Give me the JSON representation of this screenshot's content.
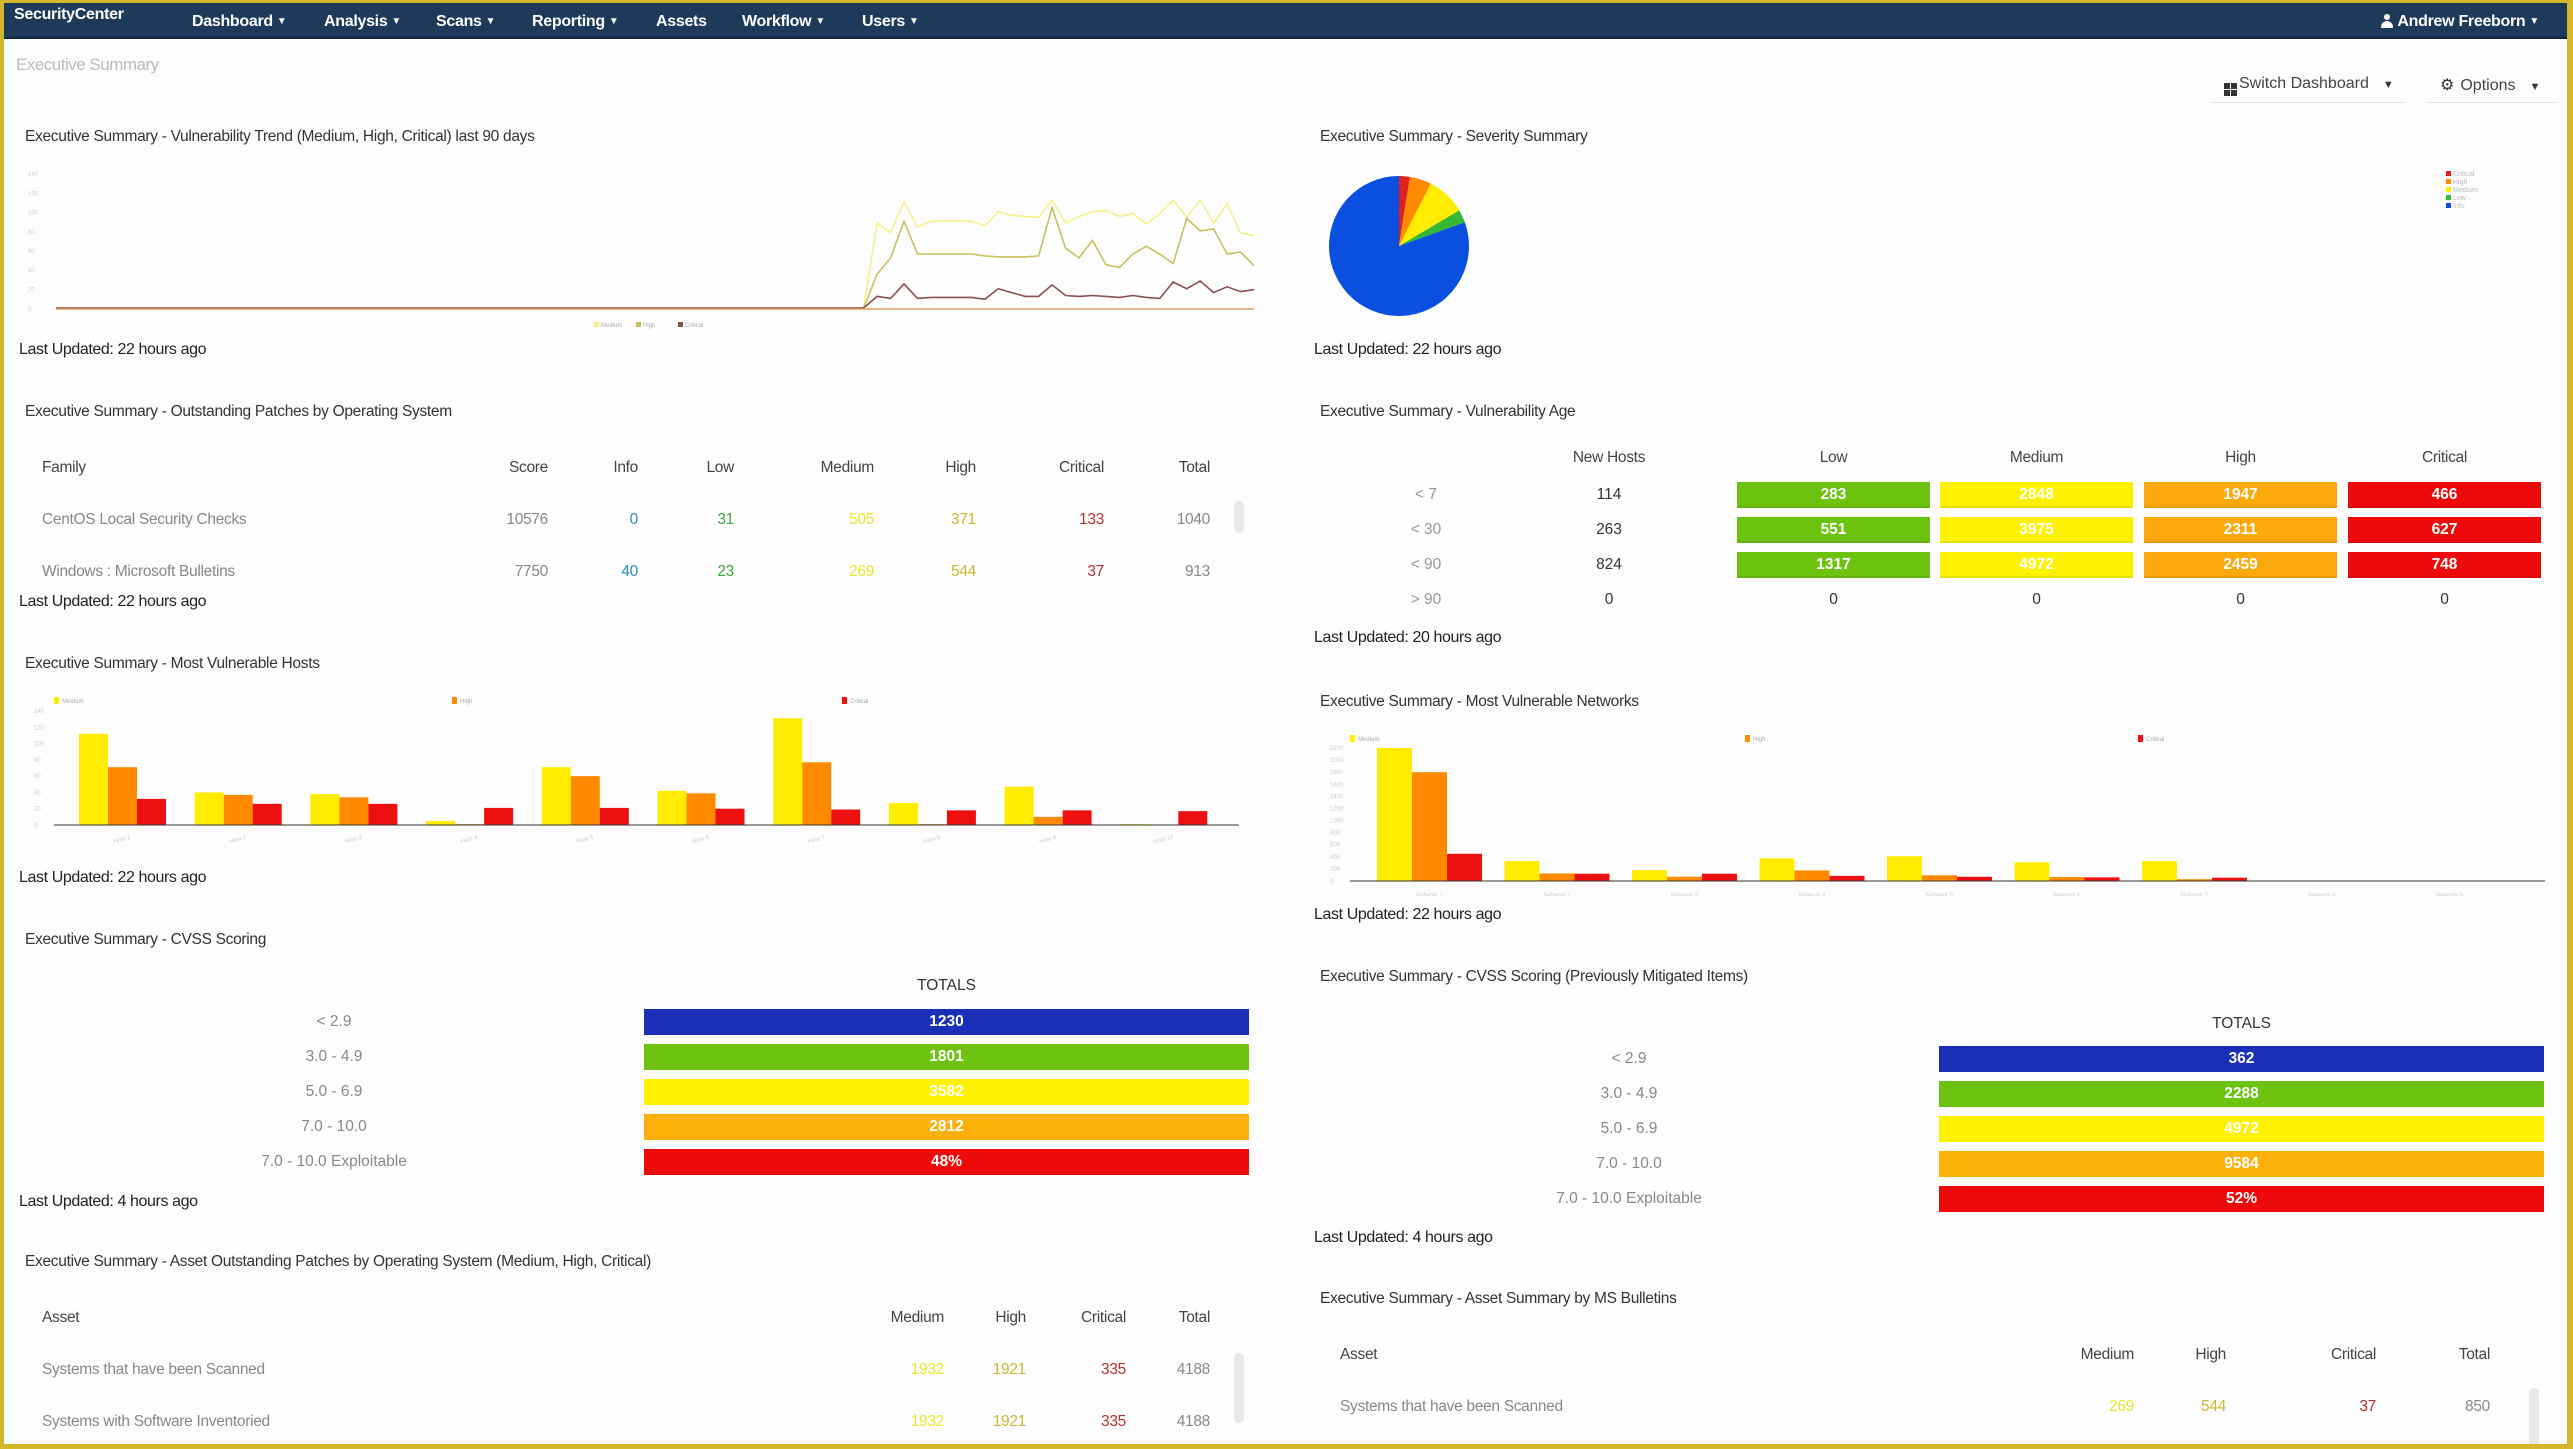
{
  "app": {
    "brand": "SecurityCenter",
    "nav": [
      "Dashboard",
      "Analysis",
      "Scans",
      "Reporting",
      "Assets",
      "Workflow",
      "Users"
    ],
    "nav_has_caret": [
      true,
      true,
      true,
      true,
      false,
      true,
      true
    ],
    "user": "Andrew Freeborn",
    "page_title": "Executive Summary",
    "switch_dashboard": "Switch Dashboard",
    "options": "Options"
  },
  "colors": {
    "nav_bg": "#1d3a5a",
    "frame": "#d4b62a",
    "info": "#0a4fe0",
    "low": "#6cc20f",
    "medium": "#fff200",
    "high": "#fba90a",
    "high_bar": "#ff8a00",
    "critical": "#ee0a0a",
    "cvss_low": "#1a2fb8"
  },
  "panels": {
    "trend": {
      "title": "Executive Summary - Vulnerability Trend (Medium, High, Critical) last 90 days",
      "updated": "Last Updated: 22 hours ago"
    },
    "severity": {
      "title": "Executive Summary - Severity Summary",
      "updated": "Last Updated: 22 hours ago"
    },
    "patches": {
      "title": "Executive Summary - Outstanding Patches by Operating System",
      "updated": "Last Updated: 22 hours ago",
      "headers": [
        "Family",
        "Score",
        "Info",
        "Low",
        "Medium",
        "High",
        "Critical",
        "Total"
      ],
      "rows": [
        {
          "family": "CentOS Local Security Checks",
          "score": "10576",
          "info": "0",
          "low": "31",
          "medium": "505",
          "high": "371",
          "critical": "133",
          "total": "1040"
        },
        {
          "family": "Windows : Microsoft Bulletins",
          "score": "7750",
          "info": "40",
          "low": "23",
          "medium": "269",
          "high": "544",
          "critical": "37",
          "total": "913"
        }
      ]
    },
    "age": {
      "title": "Executive Summary - Vulnerability Age",
      "updated": "Last Updated: 20 hours ago",
      "headers": [
        "New Hosts",
        "Low",
        "Medium",
        "High",
        "Critical"
      ],
      "rows": [
        {
          "label": "< 7",
          "new_hosts": "114",
          "low": "283",
          "medium": "2848",
          "high": "1947",
          "critical": "466"
        },
        {
          "label": "< 30",
          "new_hosts": "263",
          "low": "551",
          "medium": "3975",
          "high": "2311",
          "critical": "627"
        },
        {
          "label": "< 90",
          "new_hosts": "824",
          "low": "1317",
          "medium": "4972",
          "high": "2459",
          "critical": "748"
        },
        {
          "label": "> 90",
          "new_hosts": "0",
          "low": "0",
          "medium": "0",
          "high": "0",
          "critical": "0"
        }
      ]
    },
    "hosts": {
      "title": "Executive Summary - Most Vulnerable Hosts",
      "updated": "Last Updated: 22 hours ago"
    },
    "networks": {
      "title": "Executive Summary - Most Vulnerable Networks",
      "updated": "Last Updated: 22 hours ago"
    },
    "cvss": {
      "title": "Executive Summary - CVSS Scoring",
      "updated": "Last Updated: 4 hours ago",
      "totals_label": "TOTALS",
      "rows": [
        {
          "label": "< 2.9",
          "value": "1230",
          "color": "#1a2fb8"
        },
        {
          "label": "3.0 - 4.9",
          "value": "1801",
          "color": "#6cc20f"
        },
        {
          "label": "5.0 - 6.9",
          "value": "3582",
          "color": "#fff200"
        },
        {
          "label": "7.0 - 10.0",
          "value": "2812",
          "color": "#fbb00a"
        },
        {
          "label": "7.0 - 10.0 Exploitable",
          "value": "48%",
          "color": "#ee0a0a"
        }
      ]
    },
    "cvss_mitigated": {
      "title": "Executive Summary - CVSS Scoring (Previously Mitigated Items)",
      "updated": "Last Updated: 4 hours ago",
      "totals_label": "TOTALS",
      "rows": [
        {
          "label": "< 2.9",
          "value": "362",
          "color": "#1a2fb8"
        },
        {
          "label": "3.0 - 4.9",
          "value": "2288",
          "color": "#6cc20f"
        },
        {
          "label": "5.0 - 6.9",
          "value": "4972",
          "color": "#fff200"
        },
        {
          "label": "7.0 - 10.0",
          "value": "9584",
          "color": "#fbb00a"
        },
        {
          "label": "7.0 - 10.0 Exploitable",
          "value": "52%",
          "color": "#ee0a0a"
        }
      ]
    },
    "asset_patches": {
      "title": "Executive Summary - Asset Outstanding Patches by Operating System (Medium, High, Critical)",
      "headers": [
        "Asset",
        "Medium",
        "High",
        "Critical",
        "Total"
      ],
      "rows": [
        {
          "asset": "Systems that have been Scanned",
          "medium": "1932",
          "high": "1921",
          "critical": "335",
          "total": "4188"
        },
        {
          "asset": "Systems with Software Inventoried",
          "medium": "1932",
          "high": "1921",
          "critical": "335",
          "total": "4188"
        }
      ]
    },
    "ms_bulletins": {
      "title": "Executive Summary - Asset Summary by MS Bulletins",
      "headers": [
        "Asset",
        "Medium",
        "High",
        "Critical",
        "Total"
      ],
      "rows": [
        {
          "asset": "Systems that have been Scanned",
          "medium": "269",
          "high": "544",
          "critical": "37",
          "total": "850"
        }
      ]
    }
  },
  "chart_data": [
    {
      "id": "trend",
      "type": "line",
      "title": "Executive Summary - Vulnerability Trend (Medium, High, Critical) last 90 days",
      "xlabel": "",
      "ylabel": "",
      "ylim": [
        0,
        140
      ],
      "legend": "bottom",
      "legend_entries": [
        "Medium",
        "High",
        "Critical"
      ],
      "points_count": 90,
      "series": [
        {
          "name": "Medium",
          "color": "#f5f08a",
          "values": [
            0,
            0,
            0,
            0,
            0,
            0,
            0,
            0,
            0,
            0,
            0,
            0,
            0,
            0,
            0,
            0,
            0,
            0,
            0,
            0,
            0,
            0,
            0,
            0,
            0,
            0,
            0,
            0,
            0,
            0,
            0,
            0,
            0,
            0,
            0,
            0,
            0,
            0,
            0,
            0,
            0,
            0,
            0,
            0,
            0,
            0,
            0,
            0,
            0,
            0,
            0,
            0,
            0,
            0,
            0,
            0,
            0,
            0,
            0,
            0,
            0,
            88,
            78,
            110,
            84,
            90,
            90,
            90,
            90,
            85,
            100,
            96,
            95,
            94,
            112,
            88,
            95,
            100,
            101,
            95,
            98,
            87,
            98,
            112,
            94,
            112,
            88,
            108,
            78,
            75
          ]
        },
        {
          "name": "High",
          "color": "#c8c060",
          "values": [
            0,
            0,
            0,
            0,
            0,
            0,
            0,
            0,
            0,
            0,
            0,
            0,
            0,
            0,
            0,
            0,
            0,
            0,
            0,
            0,
            0,
            0,
            0,
            0,
            0,
            0,
            0,
            0,
            0,
            0,
            0,
            0,
            0,
            0,
            0,
            0,
            0,
            0,
            0,
            0,
            0,
            0,
            0,
            0,
            0,
            0,
            0,
            0,
            0,
            0,
            0,
            0,
            0,
            0,
            0,
            0,
            0,
            0,
            0,
            0,
            0,
            35,
            52,
            90,
            56,
            56,
            56,
            56,
            56,
            54,
            53,
            53,
            53,
            54,
            104,
            62,
            52,
            70,
            45,
            42,
            56,
            64,
            56,
            46,
            93,
            80,
            82,
            56,
            58,
            44
          ]
        },
        {
          "name": "Critical",
          "color": "#8a5050",
          "values": [
            0,
            0,
            0,
            0,
            0,
            0,
            0,
            0,
            0,
            0,
            0,
            0,
            0,
            0,
            0,
            0,
            0,
            0,
            0,
            0,
            0,
            0,
            0,
            0,
            0,
            0,
            0,
            0,
            0,
            0,
            0,
            0,
            0,
            0,
            0,
            0,
            0,
            0,
            0,
            0,
            0,
            0,
            0,
            0,
            0,
            0,
            0,
            0,
            0,
            0,
            0,
            0,
            0,
            0,
            0,
            0,
            0,
            0,
            0,
            0,
            0,
            12,
            10,
            25,
            10,
            11,
            11,
            11,
            11,
            9,
            20,
            16,
            12,
            12,
            24,
            13,
            12,
            13,
            12,
            11,
            13,
            11,
            10,
            27,
            20,
            28,
            16,
            22,
            17,
            19
          ]
        }
      ]
    },
    {
      "id": "severity",
      "type": "pie",
      "title": "Executive Summary - Severity Summary",
      "legend": "top-right",
      "categories": [
        "Critical",
        "High",
        "Medium",
        "Low",
        "Info"
      ],
      "values": [
        2.5,
        5,
        9,
        3,
        80.5
      ],
      "colors": [
        "#e02020",
        "#ff8a00",
        "#ffec00",
        "#35b835",
        "#0a4fe0"
      ]
    },
    {
      "id": "hosts",
      "type": "bar",
      "title": "Executive Summary - Most Vulnerable Hosts",
      "legend": "top",
      "ylim": [
        0,
        140
      ],
      "categories": [
        "Host 1",
        "Host 2",
        "Host 3",
        "Host 4",
        "Host 5",
        "Host 6",
        "Host 7",
        "Host 8",
        "Host 9",
        "Host 10"
      ],
      "series": [
        {
          "name": "Medium",
          "color": "#ffec00",
          "values": [
            112,
            40,
            38,
            5,
            71,
            42,
            131,
            27,
            47,
            1
          ]
        },
        {
          "name": "High",
          "color": "#ff8a00",
          "values": [
            71,
            37,
            34,
            1,
            60,
            39,
            77,
            1,
            10,
            0
          ]
        },
        {
          "name": "Critical",
          "color": "#ee1010",
          "values": [
            32,
            26,
            26,
            21,
            21,
            20,
            19,
            18,
            18,
            17
          ]
        }
      ]
    },
    {
      "id": "networks",
      "type": "bar",
      "title": "Executive Summary - Most Vulnerable Networks",
      "legend": "top",
      "ylim": [
        0,
        2200
      ],
      "categories": [
        "Network 1",
        "Network 2",
        "Network 3",
        "Network 4",
        "Network 5",
        "Network 6",
        "Network 7",
        "Network 8",
        "Network 9"
      ],
      "series": [
        {
          "name": "Medium",
          "color": "#ffec00",
          "values": [
            2200,
            330,
            180,
            375,
            410,
            310,
            330,
            0,
            0
          ]
        },
        {
          "name": "High",
          "color": "#ff8a00",
          "values": [
            1800,
            125,
            70,
            175,
            95,
            65,
            30,
            0,
            0
          ]
        },
        {
          "name": "Critical",
          "color": "#ee1010",
          "values": [
            450,
            120,
            120,
            85,
            70,
            60,
            55,
            0,
            0
          ]
        }
      ]
    }
  ]
}
